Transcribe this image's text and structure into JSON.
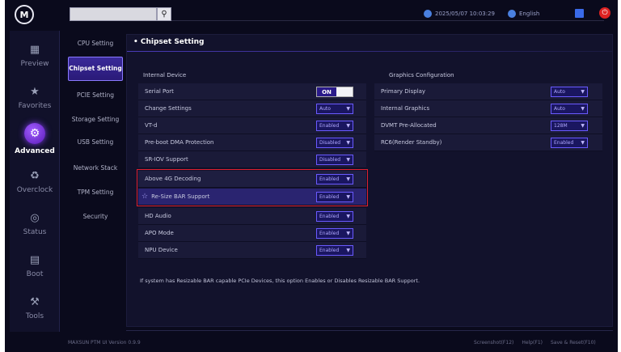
{
  "topbar": {
    "search_placeholder": "",
    "datetime": "2025/05/07 10:03:29",
    "language": "English"
  },
  "left_nav": [
    {
      "label": "Preview",
      "icon": "grid-icon"
    },
    {
      "label": "Favorites",
      "icon": "star-icon"
    },
    {
      "label": "Advanced",
      "icon": "advanced-icon",
      "active": true
    },
    {
      "label": "Overclock",
      "icon": "overclock-icon"
    },
    {
      "label": "Status",
      "icon": "status-icon"
    },
    {
      "label": "Boot",
      "icon": "boot-icon"
    },
    {
      "label": "Tools",
      "icon": "tools-icon"
    }
  ],
  "submenu": [
    {
      "label": "CPU Setting"
    },
    {
      "label": "Chipset Setting",
      "active": true
    },
    {
      "label": "PCIE Setting"
    },
    {
      "label": "Storage Setting"
    },
    {
      "label": "USB Setting"
    },
    {
      "label": "Network Stack"
    },
    {
      "label": "TPM Setting"
    },
    {
      "label": "Security"
    }
  ],
  "panel": {
    "title": "Chipset Setting",
    "left_heading": "Internal Device",
    "right_heading": "Graphics Configuration",
    "left_rows": [
      {
        "label": "Serial Port",
        "control": "toggle",
        "value": "ON"
      },
      {
        "label": "Change Settings",
        "control": "select",
        "value": "Auto"
      },
      {
        "label": "VT-d",
        "control": "select",
        "value": "Enabled"
      },
      {
        "label": "Pre-boot DMA Protection",
        "control": "select",
        "value": "Disabled"
      },
      {
        "label": "SR-IOV Support",
        "control": "select",
        "value": "Disabled"
      },
      {
        "label": "Above 4G Decoding",
        "control": "select",
        "value": "Enabled"
      },
      {
        "label": "Re-Size BAR Support",
        "control": "select",
        "value": "Enabled"
      },
      {
        "label": "HD Audio",
        "control": "select",
        "value": "Enabled"
      },
      {
        "label": "APO Mode",
        "control": "select",
        "value": "Enabled"
      },
      {
        "label": "NPU Device",
        "control": "select",
        "value": "Enabled"
      }
    ],
    "right_rows": [
      {
        "label": "Primary Display",
        "value": "Auto"
      },
      {
        "label": "Internal Graphics",
        "value": "Auto"
      },
      {
        "label": "DVMT Pre-Allocated",
        "value": "128M"
      },
      {
        "label": "RC6(Render Standby)",
        "value": "Enabled"
      }
    ],
    "help_text": "If system has Resizable BAR capable PCIe Devices, this option Enables or Disables Resizable BAR Support."
  },
  "footer": {
    "version": "MAXSUN PTM UI Version 0.9.9",
    "screenshot": "Screenshot(F12)",
    "help": "Help(F1)",
    "save": "Save & Reset(F10)"
  }
}
